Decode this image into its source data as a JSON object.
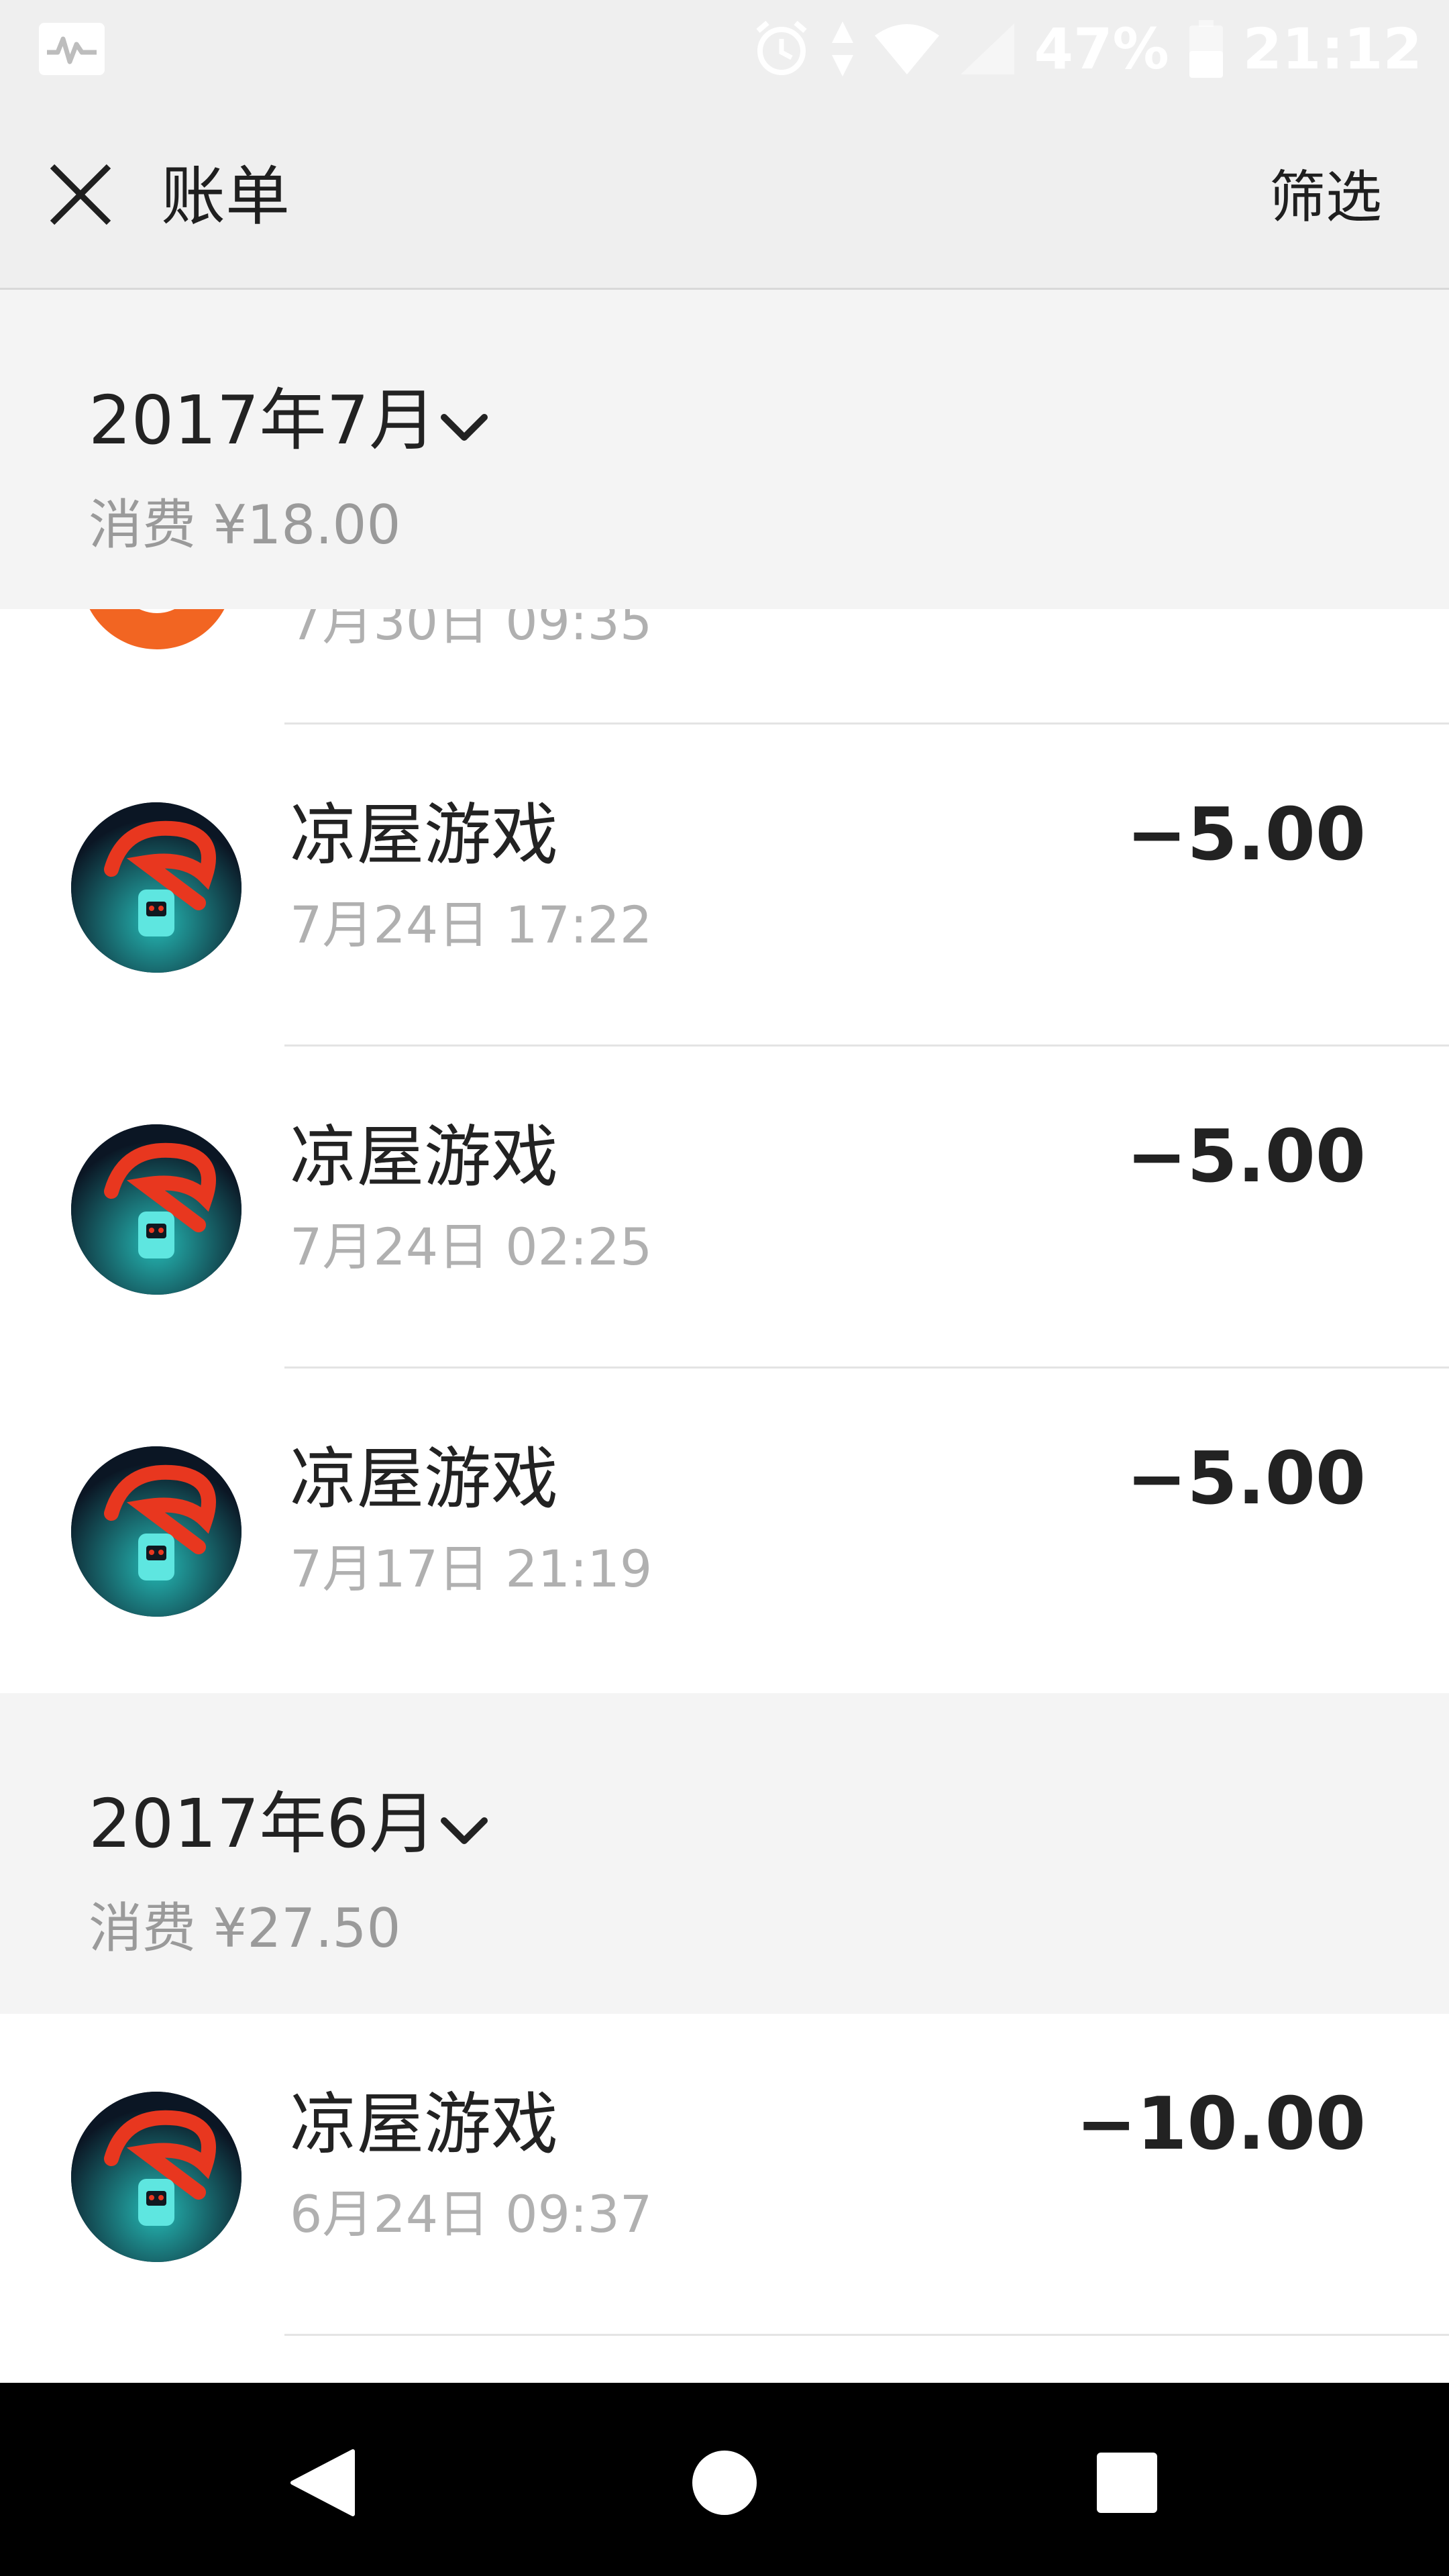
{
  "status_bar": {
    "battery": "47%",
    "time": "21:12",
    "icons": [
      "activity-icon",
      "alarm-icon",
      "data-arrows-icon",
      "wifi-icon",
      "signal-icon",
      "battery-icon"
    ]
  },
  "header": {
    "title": "账单",
    "filter_label": "筛选",
    "close_icon": "close-icon"
  },
  "months": [
    {
      "title": "2017年7月",
      "summary": "消费 ¥18.00",
      "transactions": [
        {
          "name": "",
          "time": "7月30日 09:35",
          "amount": "",
          "partial": true
        },
        {
          "name": "凉屋游戏",
          "time": "7月24日 17:22",
          "amount": "−5.00"
        },
        {
          "name": "凉屋游戏",
          "time": "7月24日 02:25",
          "amount": "−5.00"
        },
        {
          "name": "凉屋游戏",
          "time": "7月17日 21:19",
          "amount": "−5.00"
        }
      ]
    },
    {
      "title": "2017年6月",
      "summary": "消费 ¥27.50",
      "transactions": [
        {
          "name": "凉屋游戏",
          "time": "6月24日 09:37",
          "amount": "−10.00"
        }
      ]
    }
  ],
  "nav_bar": {
    "buttons": [
      "back-icon",
      "home-icon",
      "recents-icon"
    ]
  },
  "colors": {
    "header_bg": "#efefef",
    "month_bg": "#f4f4f4",
    "text_primary": "#222222",
    "text_secondary": "#b0b0b0",
    "partial_avatar": "#f26522"
  }
}
